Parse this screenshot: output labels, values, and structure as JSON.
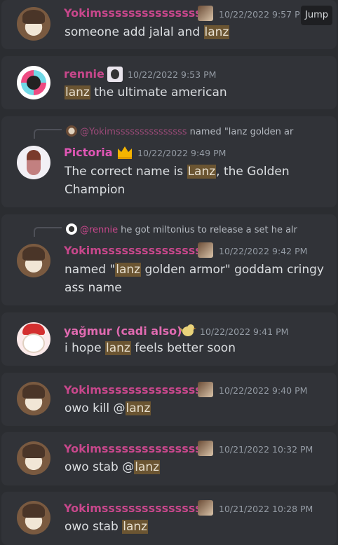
{
  "jump_label": "Jump",
  "messages": [
    {
      "author": "Yokimsssssssssssssss",
      "timestamp": "10/22/2022 9:57 P",
      "pre": "someone add jalal and ",
      "hl": "lanz",
      "post": ""
    },
    {
      "author": "rennie",
      "timestamp": "10/22/2022 9:53 PM",
      "pre": "",
      "hl": "lanz",
      "post": " the ultimate american"
    },
    {
      "author": "Pictoria",
      "timestamp": "10/22/2022 9:49 PM",
      "pre": "The correct name is ",
      "hl": "Lanz",
      "post": ", the Golden Champion",
      "reply": {
        "author": "@Yokimsssssssssssssss",
        "text": "named \"lanz golden ar"
      }
    },
    {
      "author": "Yokimsssssssssssssss",
      "timestamp": "10/22/2022 9:42 PM",
      "pre": "named \"",
      "hl": "lanz",
      "post": " golden armor\" goddam cringy ass name",
      "reply": {
        "author": "@rennie",
        "text": "he got miltonius to release a set he alr"
      }
    },
    {
      "author": "yağmur (cadi also)",
      "timestamp": "10/22/2022 9:41 PM",
      "pre": "i hope ",
      "hl": "lanz",
      "post": " feels better soon"
    },
    {
      "author": "Yokimsssssssssssssss",
      "timestamp": "10/22/2022 9:40 PM",
      "pre": "owo kill @",
      "hl": "lanz",
      "post": ""
    },
    {
      "author": "Yokimsssssssssssssss",
      "timestamp": "10/21/2022 10:32 PM",
      "pre": "owo stab @",
      "hl": "lanz",
      "post": ""
    },
    {
      "author": "Yokimsssssssssssssss",
      "timestamp": "10/21/2022 10:28 PM",
      "pre": "owo stab ",
      "hl": "lanz",
      "post": ""
    }
  ]
}
